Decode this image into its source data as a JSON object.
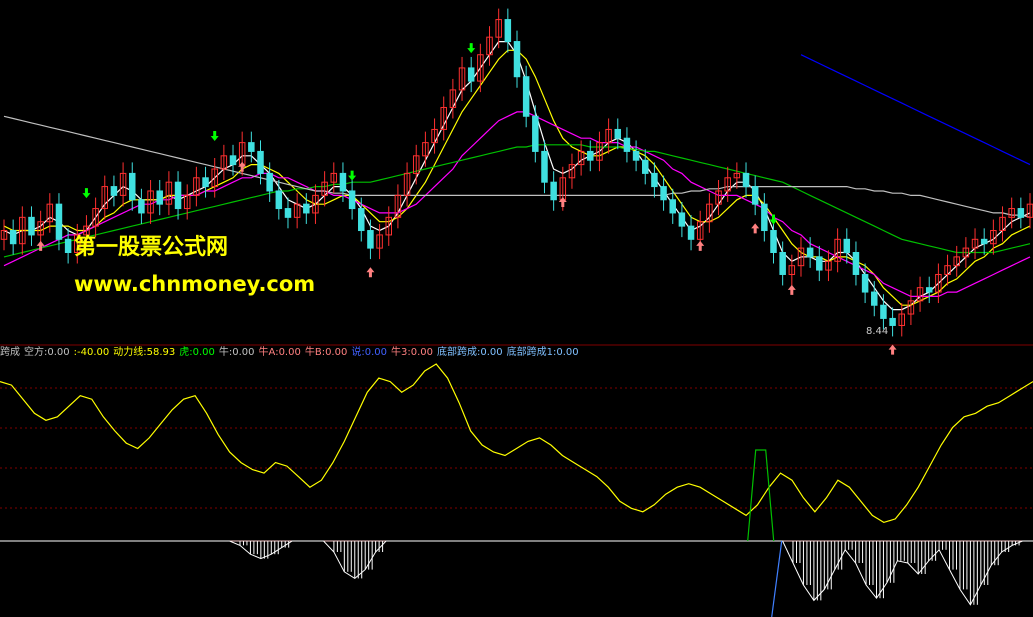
{
  "watermark": {
    "line1": "第一股票公式网",
    "line2": "www.chnmoney.com",
    "color": "#ffff00"
  },
  "price_low_label": "8.44",
  "indicator_labels": [
    {
      "text": "跨成",
      "color": "#c0c0c0"
    },
    {
      "text": "空方:0.00",
      "color": "#c0c0c0"
    },
    {
      "text": ":-40.00",
      "color": "#ffff00"
    },
    {
      "text": "动力线:58.93",
      "color": "#ffff00"
    },
    {
      "text": "虎:0.00",
      "color": "#00ff00"
    },
    {
      "text": "牛:0.00",
      "color": "#c0c0c0"
    },
    {
      "text": "牛A:0.00",
      "color": "#ff8080"
    },
    {
      "text": "牛B:0.00",
      "color": "#ff8080"
    },
    {
      "text": "说:0.00",
      "color": "#4060ff"
    },
    {
      "text": "牛3:0.00",
      "color": "#ff8080"
    },
    {
      "text": "底部跨成:0.00",
      "color": "#80c0ff"
    },
    {
      "text": "底部跨成1:0.00",
      "color": "#80c0ff"
    }
  ],
  "colors": {
    "background": "#000000",
    "up_candle": "#ff3030",
    "down_candle": "#40e0e0",
    "ma_white": "#ffffff",
    "ma_yellow": "#ffff00",
    "ma_magenta": "#ff00ff",
    "ma_green": "#00c000",
    "ma_gray": "#c0c0c0",
    "ma_blue": "#0000ff",
    "power_line": "#ffff00",
    "bottom_signal": "#00c000",
    "histogram": "#ffffff",
    "grid": "#800000"
  },
  "chart_data": [
    {
      "type": "candlestick",
      "title": "",
      "series_note": "daily K-line with moving averages, buy arrows and sell arrows",
      "closes": [
        10.6,
        10.3,
        10.9,
        10.5,
        10.8,
        11.2,
        10.4,
        10.1,
        10.5,
        10.7,
        11.1,
        11.6,
        11.4,
        11.9,
        11.3,
        11.0,
        11.5,
        11.2,
        11.7,
        11.1,
        11.4,
        11.8,
        11.6,
        12.0,
        12.3,
        12.1,
        12.6,
        12.4,
        11.9,
        11.5,
        11.1,
        10.9,
        11.2,
        11.0,
        11.4,
        11.7,
        11.9,
        11.5,
        11.1,
        10.6,
        10.2,
        10.5,
        10.9,
        11.4,
        11.9,
        12.3,
        12.6,
        12.9,
        13.4,
        13.8,
        14.3,
        14.0,
        14.6,
        15.0,
        15.4,
        14.9,
        14.1,
        13.2,
        12.4,
        11.7,
        11.3,
        11.8,
        12.1,
        12.4,
        12.2,
        12.6,
        12.9,
        12.7,
        12.4,
        12.2,
        11.9,
        11.6,
        11.3,
        11.0,
        10.7,
        10.4,
        10.8,
        11.2,
        11.5,
        11.8,
        11.9,
        11.6,
        11.2,
        10.6,
        10.1,
        9.6,
        9.8,
        10.2,
        10.0,
        9.7,
        9.9,
        10.4,
        10.1,
        9.6,
        9.2,
        8.9,
        8.6,
        8.44,
        8.7,
        9.0,
        9.3,
        9.2,
        9.6,
        9.8,
        10.0,
        10.2,
        10.4,
        10.3,
        10.6,
        10.9,
        11.1,
        10.9,
        11.2
      ],
      "ma_lines": [
        {
          "label": "",
          "color": "#ffffff",
          "values": [
            10.6,
            10.5,
            10.6,
            10.6,
            10.7,
            10.9,
            10.8,
            10.6,
            10.5,
            10.6,
            10.9,
            11.2,
            11.4,
            11.6,
            11.5,
            11.3,
            11.3,
            11.3,
            11.4,
            11.3,
            11.4,
            11.5,
            11.6,
            11.8,
            12.0,
            12.1,
            12.3,
            12.3,
            12.1,
            11.9,
            11.6,
            11.3,
            11.2,
            11.1,
            11.2,
            11.4,
            11.6,
            11.6,
            11.4,
            11.1,
            10.7,
            10.6,
            10.7,
            11.0,
            11.4,
            11.8,
            12.2,
            12.6,
            13.0,
            13.4,
            13.8,
            14.0,
            14.3,
            14.6,
            14.9,
            14.9,
            14.6,
            14.0,
            13.3,
            12.6,
            12.0,
            11.9,
            12.0,
            12.2,
            12.3,
            12.4,
            12.6,
            12.7,
            12.6,
            12.4,
            12.1,
            11.8,
            11.5,
            11.2,
            10.9,
            10.6,
            10.7,
            10.9,
            11.2,
            11.5,
            11.7,
            11.7,
            11.5,
            11.1,
            10.6,
            10.1,
            9.9,
            10.0,
            10.0,
            9.9,
            9.9,
            10.1,
            10.1,
            9.9,
            9.6,
            9.3,
            9.0,
            8.8,
            8.8,
            8.9,
            9.1,
            9.2,
            9.4,
            9.6,
            9.8,
            10.0,
            10.2,
            10.3,
            10.4,
            10.6,
            10.8,
            10.9,
            11.0
          ]
        },
        {
          "label": "",
          "color": "#ffff00",
          "values": [
            10.7,
            10.6,
            10.6,
            10.6,
            10.6,
            10.7,
            10.7,
            10.7,
            10.6,
            10.6,
            10.7,
            10.9,
            11.0,
            11.2,
            11.3,
            11.3,
            11.3,
            11.3,
            11.4,
            11.4,
            11.4,
            11.4,
            11.5,
            11.6,
            11.7,
            11.8,
            12.0,
            12.1,
            12.1,
            12.0,
            11.9,
            11.7,
            11.5,
            11.3,
            11.2,
            11.2,
            11.3,
            11.4,
            11.4,
            11.2,
            11.0,
            10.8,
            10.8,
            10.9,
            11.1,
            11.4,
            11.7,
            12.1,
            12.5,
            12.9,
            13.3,
            13.6,
            13.9,
            14.2,
            14.5,
            14.7,
            14.7,
            14.5,
            14.1,
            13.6,
            13.1,
            12.7,
            12.5,
            12.4,
            12.3,
            12.3,
            12.4,
            12.5,
            12.5,
            12.4,
            12.3,
            12.1,
            11.8,
            11.5,
            11.2,
            10.9,
            10.8,
            10.8,
            10.9,
            11.1,
            11.3,
            11.4,
            11.4,
            11.2,
            10.9,
            10.6,
            10.3,
            10.1,
            10.0,
            10.0,
            9.9,
            10.0,
            10.0,
            9.9,
            9.8,
            9.6,
            9.3,
            9.1,
            8.9,
            8.9,
            9.0,
            9.1,
            9.2,
            9.4,
            9.5,
            9.7,
            9.9,
            10.0,
            10.2,
            10.3,
            10.5,
            10.6,
            10.7
          ]
        },
        {
          "label": "",
          "color": "#ff00ff",
          "values": [
            9.8,
            9.9,
            10.0,
            10.1,
            10.2,
            10.3,
            10.4,
            10.5,
            10.5,
            10.6,
            10.7,
            10.8,
            10.9,
            11.0,
            11.1,
            11.2,
            11.2,
            11.3,
            11.3,
            11.4,
            11.4,
            11.4,
            11.5,
            11.5,
            11.6,
            11.7,
            11.8,
            11.8,
            11.9,
            11.9,
            11.8,
            11.8,
            11.7,
            11.6,
            11.5,
            11.5,
            11.4,
            11.4,
            11.3,
            11.2,
            11.1,
            11.0,
            11.0,
            11.0,
            11.1,
            11.2,
            11.4,
            11.6,
            11.8,
            12.0,
            12.3,
            12.5,
            12.7,
            12.9,
            13.1,
            13.2,
            13.3,
            13.3,
            13.2,
            13.1,
            13.0,
            12.9,
            12.8,
            12.7,
            12.7,
            12.6,
            12.6,
            12.6,
            12.5,
            12.5,
            12.4,
            12.3,
            12.2,
            12.0,
            11.9,
            11.7,
            11.6,
            11.5,
            11.4,
            11.4,
            11.4,
            11.3,
            11.2,
            11.1,
            10.9,
            10.8,
            10.6,
            10.5,
            10.3,
            10.2,
            10.1,
            10.0,
            9.9,
            9.8,
            9.7,
            9.6,
            9.4,
            9.3,
            9.2,
            9.1,
            9.1,
            9.1,
            9.1,
            9.2,
            9.2,
            9.3,
            9.4,
            9.5,
            9.6,
            9.7,
            9.8,
            9.9,
            10.0
          ]
        },
        {
          "label": "",
          "color": "#00c000",
          "values": [
            10.0,
            10.05,
            10.1,
            10.15,
            10.2,
            10.25,
            10.3,
            10.35,
            10.4,
            10.45,
            10.5,
            10.55,
            10.6,
            10.65,
            10.7,
            10.75,
            10.8,
            10.85,
            10.9,
            10.95,
            11.0,
            11.05,
            11.1,
            11.15,
            11.2,
            11.25,
            11.3,
            11.35,
            11.4,
            11.45,
            11.5,
            11.5,
            11.55,
            11.55,
            11.6,
            11.6,
            11.65,
            11.65,
            11.7,
            11.7,
            11.7,
            11.75,
            11.8,
            11.85,
            11.9,
            11.95,
            12.0,
            12.05,
            12.1,
            12.15,
            12.2,
            12.25,
            12.3,
            12.35,
            12.4,
            12.45,
            12.5,
            12.5,
            12.55,
            12.55,
            12.55,
            12.55,
            12.55,
            12.55,
            12.5,
            12.5,
            12.5,
            12.5,
            12.45,
            12.45,
            12.4,
            12.4,
            12.35,
            12.3,
            12.25,
            12.2,
            12.15,
            12.1,
            12.05,
            12.0,
            11.95,
            11.9,
            11.85,
            11.8,
            11.75,
            11.7,
            11.6,
            11.5,
            11.4,
            11.3,
            11.2,
            11.1,
            11.0,
            10.9,
            10.8,
            10.7,
            10.6,
            10.5,
            10.4,
            10.35,
            10.3,
            10.25,
            10.2,
            10.15,
            10.1,
            10.1,
            10.1,
            10.1,
            10.1,
            10.15,
            10.2,
            10.25,
            10.3
          ]
        },
        {
          "label": "",
          "color": "#c0c0c0",
          "values": [
            13.2,
            13.15,
            13.1,
            13.05,
            13.0,
            12.95,
            12.9,
            12.85,
            12.8,
            12.75,
            12.7,
            12.65,
            12.6,
            12.55,
            12.5,
            12.45,
            12.4,
            12.35,
            12.3,
            12.25,
            12.2,
            12.15,
            12.1,
            12.05,
            12.0,
            11.95,
            11.9,
            11.85,
            11.8,
            11.75,
            11.7,
            11.65,
            11.6,
            11.55,
            11.5,
            11.5,
            11.45,
            11.45,
            11.4,
            11.4,
            11.4,
            11.4,
            11.4,
            11.4,
            11.4,
            11.4,
            11.4,
            11.4,
            11.4,
            11.4,
            11.4,
            11.4,
            11.4,
            11.4,
            11.4,
            11.4,
            11.4,
            11.4,
            11.4,
            11.4,
            11.4,
            11.4,
            11.4,
            11.4,
            11.4,
            11.4,
            11.4,
            11.4,
            11.4,
            11.4,
            11.4,
            11.4,
            11.4,
            11.45,
            11.45,
            11.5,
            11.5,
            11.55,
            11.55,
            11.6,
            11.6,
            11.6,
            11.6,
            11.6,
            11.6,
            11.6,
            11.6,
            11.6,
            11.6,
            11.6,
            11.6,
            11.6,
            11.6,
            11.55,
            11.55,
            11.5,
            11.5,
            11.45,
            11.45,
            11.4,
            11.4,
            11.35,
            11.3,
            11.25,
            11.2,
            11.15,
            11.1,
            11.05,
            11.0,
            11.0,
            10.95,
            10.95,
            10.9
          ]
        },
        {
          "label": "",
          "color": "#0000ff",
          "values": [
            null,
            null,
            null,
            null,
            null,
            null,
            null,
            null,
            null,
            null,
            null,
            null,
            null,
            null,
            null,
            null,
            null,
            null,
            null,
            null,
            null,
            null,
            null,
            null,
            null,
            null,
            null,
            null,
            null,
            null,
            null,
            null,
            null,
            null,
            null,
            null,
            null,
            null,
            null,
            null,
            null,
            null,
            null,
            null,
            null,
            null,
            null,
            null,
            null,
            null,
            null,
            null,
            null,
            null,
            null,
            null,
            null,
            null,
            null,
            null,
            null,
            null,
            null,
            null,
            null,
            null,
            null,
            null,
            null,
            null,
            null,
            null,
            null,
            null,
            null,
            null,
            null,
            null,
            null,
            null,
            null,
            null,
            null,
            null,
            null,
            null,
            null,
            14.6,
            14.5,
            14.4,
            14.3,
            14.2,
            14.1,
            14.0,
            13.9,
            13.8,
            13.7,
            13.6,
            13.5,
            13.4,
            13.3,
            13.2,
            13.1,
            13.0,
            12.9,
            12.8,
            12.7,
            12.6,
            12.5,
            12.4,
            12.3,
            12.2,
            12.1
          ]
        }
      ],
      "buy_arrows_at": [
        4,
        26,
        40,
        61,
        76,
        82,
        86,
        97
      ],
      "sell_arrows_at": [
        9,
        23,
        38,
        51,
        84
      ],
      "low_label": "8.44"
    },
    {
      "type": "line",
      "title": "",
      "series": [
        {
          "name": "动力线",
          "color": "#ffff00",
          "values": [
            90,
            88,
            80,
            72,
            68,
            70,
            76,
            82,
            80,
            70,
            62,
            55,
            52,
            58,
            66,
            74,
            80,
            82,
            72,
            60,
            50,
            44,
            40,
            38,
            44,
            42,
            36,
            30,
            34,
            44,
            56,
            70,
            84,
            92,
            90,
            84,
            88,
            96,
            100,
            92,
            78,
            62,
            54,
            50,
            48,
            52,
            56,
            58,
            54,
            48,
            44,
            40,
            36,
            30,
            22,
            18,
            16,
            20,
            26,
            30,
            32,
            30,
            26,
            22,
            18,
            14,
            20,
            30,
            38,
            34,
            24,
            16,
            24,
            34,
            30,
            22,
            14,
            10,
            12,
            20,
            30,
            42,
            54,
            64,
            70,
            72,
            76,
            78,
            82,
            86,
            90
          ]
        }
      ],
      "ylim": [
        0,
        100
      ]
    },
    {
      "type": "bar",
      "title": "",
      "series": [
        {
          "name": "空方",
          "color": "#ffffff",
          "values": [
            0,
            0,
            0,
            0,
            0,
            0,
            0,
            0,
            0,
            0,
            0,
            0,
            0,
            0,
            0,
            0,
            0,
            0,
            0,
            0,
            0,
            0,
            0,
            -4,
            -12,
            -16,
            -12,
            -6,
            0,
            0,
            0,
            0,
            -10,
            -28,
            -34,
            -26,
            -10,
            0,
            0,
            0,
            0,
            0,
            0,
            0,
            0,
            0,
            0,
            0,
            0,
            0,
            0,
            0,
            0,
            0,
            0,
            0,
            0,
            0,
            0,
            0,
            0,
            0,
            0,
            0,
            0,
            0,
            0,
            0,
            0,
            0,
            0,
            0,
            0,
            0,
            0,
            0,
            -20,
            -40,
            -54,
            -44,
            -26,
            -8,
            -20,
            -40,
            -52,
            -38,
            -18,
            -20,
            -30,
            -18,
            -8,
            -26,
            -44,
            -58,
            -40,
            -22,
            -10,
            -4,
            0,
            0
          ]
        }
      ],
      "signal": {
        "name": "底部跨成",
        "color": "#00c000",
        "spike_at": 73
      },
      "ylim": [
        -60,
        0
      ]
    }
  ]
}
